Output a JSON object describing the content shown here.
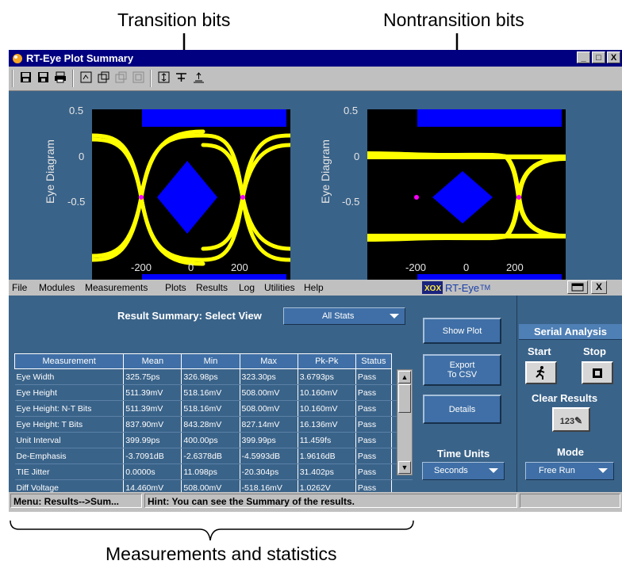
{
  "callouts": {
    "transition": "Transition bits",
    "nontransition": "Nontransition bits",
    "measurements": "Measurements and statistics"
  },
  "window": {
    "title": "RT-Eye Plot Summary",
    "controls": [
      "_",
      "□",
      "X"
    ]
  },
  "toolbar_icons": [
    "save-icon",
    "save-all-icon",
    "print-icon",
    "plot-icon-1",
    "plot-icon-2",
    "plot-icon-3",
    "plot-icon-4",
    "cursor-icon-1",
    "cursor-icon-2",
    "cursor-icon-3"
  ],
  "plots": {
    "ylabel": "Eye Diagram",
    "yticks": [
      "0.5",
      "0",
      "-0.5"
    ],
    "xticks": [
      "-200",
      "0",
      "200"
    ]
  },
  "menu": [
    "File",
    "Modules",
    "Measurements",
    "Plots",
    "Results",
    "Log",
    "Utilities",
    "Help"
  ],
  "logo": {
    "text": "RT-Eye",
    "tm": "TM"
  },
  "results": {
    "title": "Result Summary: Select View",
    "view": "All Stats",
    "columns": [
      "Measurement",
      "Mean",
      "Min",
      "Max",
      "Pk-Pk",
      "Status"
    ],
    "rows": [
      [
        "Eye Width",
        "325.75ps",
        "326.98ps",
        "323.30ps",
        "3.6793ps",
        "Pass"
      ],
      [
        "Eye Height",
        "511.39mV",
        "518.16mV",
        "508.00mV",
        "10.160mV",
        "Pass"
      ],
      [
        "Eye Height: N-T Bits",
        "511.39mV",
        "518.16mV",
        "508.00mV",
        "10.160mV",
        "Pass"
      ],
      [
        "Eye Height: T Bits",
        "837.90mV",
        "843.28mV",
        "827.14mV",
        "16.136mV",
        "Pass"
      ],
      [
        "Unit Interval",
        "399.99ps",
        "400.00ps",
        "399.99ps",
        "11.459fs",
        "Pass"
      ],
      [
        "De-Emphasis",
        "-3.7091dB",
        "-2.6378dB",
        "-4.5993dB",
        "1.9616dB",
        "Pass"
      ],
      [
        "TIE Jitter",
        "0.0000s",
        "11.098ps",
        "-20.304ps",
        "31.402ps",
        "Pass"
      ],
      [
        "Diff Voltage",
        "14.460mV",
        "508.00mV",
        "-518.16mV",
        "1.0262V",
        "Pass"
      ]
    ]
  },
  "buttons": {
    "show_plot": "Show Plot",
    "export_line1": "Export",
    "export_line2": "To CSV",
    "details": "Details"
  },
  "time_units": {
    "label": "Time Units",
    "value": "Seconds"
  },
  "serial": {
    "title": "Serial Analysis",
    "start": "Start",
    "stop": "Stop",
    "clear": "Clear Results",
    "clear_icon_text": "123",
    "mode_label": "Mode",
    "mode_value": "Free Run"
  },
  "status": {
    "menu": "Menu: Results-->Sum...",
    "hint": "Hint: You can see the Summary of the results."
  },
  "colors": {
    "panel": "#3a6389",
    "titlebar": "#000080",
    "eye": "#ffff00",
    "mask": "#0000ff",
    "marker": "#ff00ff"
  }
}
